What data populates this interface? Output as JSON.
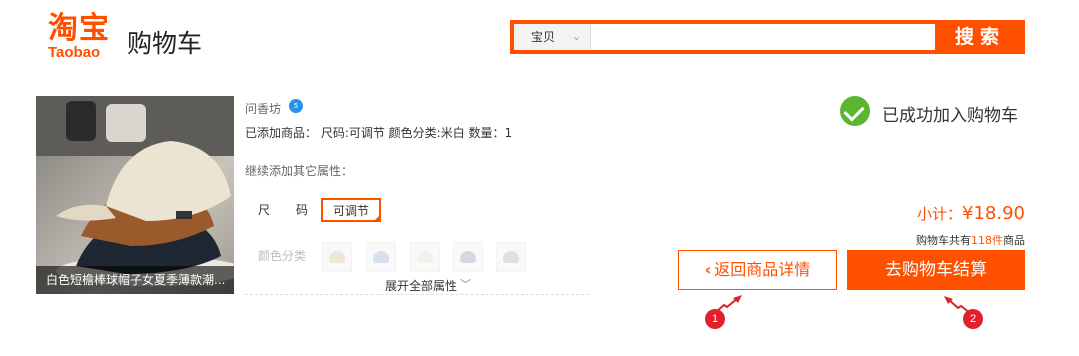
{
  "header": {
    "logo_cn": "淘宝",
    "logo_en": "Taobao",
    "title": "购物车",
    "search": {
      "category": "宝贝",
      "value": "",
      "button": "搜索"
    }
  },
  "product": {
    "caption": "白色短檐棒球帽子女夏季薄款潮...",
    "shop": "问香坊",
    "shop_badge": "5",
    "added": "已添加商品：  尺码:可调节  颜色分类:米白  数量：1",
    "continue_label": "继续添加其它属性：",
    "size_label": "尺码",
    "size_value": "可调节",
    "color_label": "颜色分类",
    "expand": "展开全部属性"
  },
  "result": {
    "success": "已成功加入购物车",
    "subtotal_label": "小计：",
    "subtotal_value": "¥18.90",
    "cart_prefix": "购物车共有",
    "cart_count": "118件",
    "cart_suffix": "商品",
    "back_button": "返回商品详情",
    "checkout_button": "去购物车结算"
  },
  "markers": [
    "1",
    "2"
  ],
  "colors": {
    "accent": "#ff5000",
    "success": "#5cb531",
    "marker": "#e0202d"
  }
}
